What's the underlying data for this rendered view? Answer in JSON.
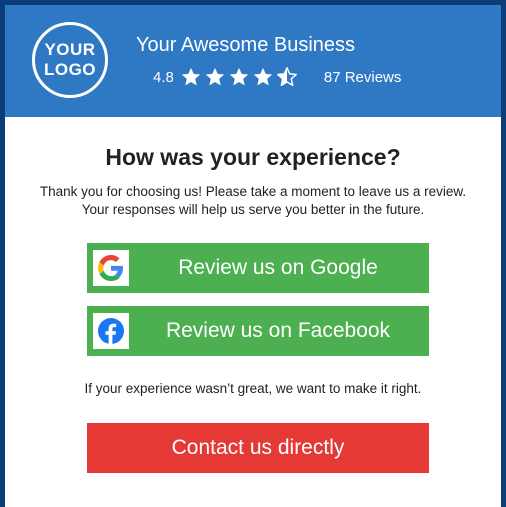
{
  "header": {
    "logo_line1": "YOUR",
    "logo_line2": "LOGO",
    "business_name": "Your Awesome Business",
    "rating": "4.8",
    "stars_value": 4.5,
    "stars_max": 5,
    "reviews_label": "87 Reviews"
  },
  "main": {
    "title": "How was your experience?",
    "intro": "Thank you for choosing us! Please take a moment to leave us a review. Your responses will help us serve you better in the future.",
    "google_button": "Review us on Google",
    "facebook_button": "Review us on Facebook",
    "note": "If your experience wasn’t great, we want to make it right.",
    "contact_button": "Contact us directly"
  },
  "icons": {
    "google": "google-icon",
    "facebook": "facebook-icon",
    "star": "star-icon"
  },
  "colors": {
    "page_border": "#0b3d7a",
    "header_bg": "#2f78c4",
    "review_button": "#4caf50",
    "contact_button": "#e53935",
    "facebook_blue": "#1877f2"
  }
}
